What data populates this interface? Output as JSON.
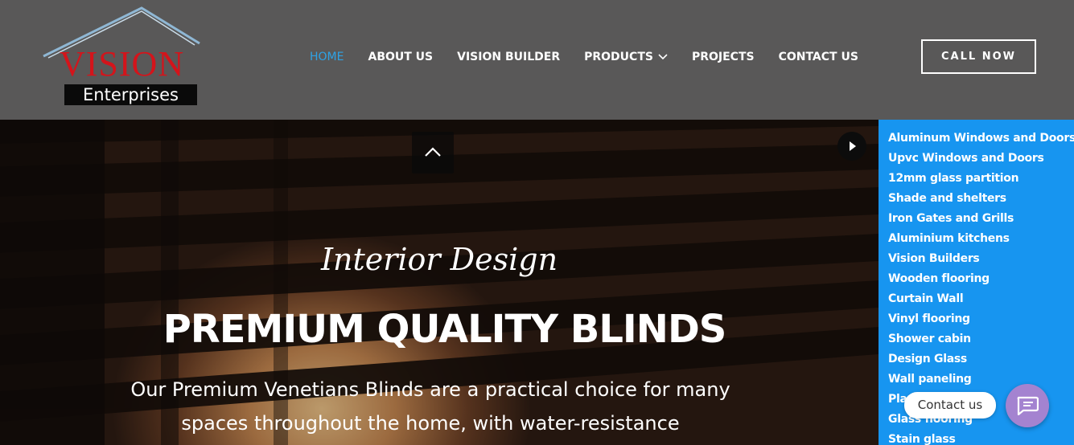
{
  "brand": {
    "name": "VISION",
    "tagline": "Enterprises"
  },
  "nav": {
    "items": [
      {
        "label": "HOME",
        "active": true
      },
      {
        "label": "ABOUT US",
        "active": false
      },
      {
        "label": "VISION BUILDER",
        "active": false
      },
      {
        "label": "PRODUCTS",
        "active": false,
        "has_dropdown": true
      },
      {
        "label": "PROJECTS",
        "active": false
      },
      {
        "label": "CONTACT US",
        "active": false
      }
    ],
    "cta_label": "CALL NOW"
  },
  "hero": {
    "script_text": "Interior Design",
    "title": "PREMIUM QUALITY BLINDS",
    "description": "Our Premium Venetians Blinds are a practical choice for many spaces throughout the home, with water-resistance"
  },
  "side_menu": {
    "items": [
      "Aluminum Windows and Doors",
      "Upvc Windows and Doors",
      "12mm glass partition",
      "Shade and shelters",
      "Iron Gates and Grills",
      "Aluminium kitchens",
      "Vision Builders",
      "Wooden flooring",
      "Curtain Wall",
      "Vinyl flooring",
      "Shower cabin",
      "Design Glass",
      "Wall paneling",
      "Pla",
      "Glass flooring",
      "Stain glass"
    ]
  },
  "contact": {
    "label": "Contact us"
  },
  "colors": {
    "header_bg": "#595858",
    "nav_active": "#2ea3e6",
    "side_panel_bg": "#1795f0",
    "chat_bubble": "#a483d0",
    "brand_red": "#d4141b"
  }
}
